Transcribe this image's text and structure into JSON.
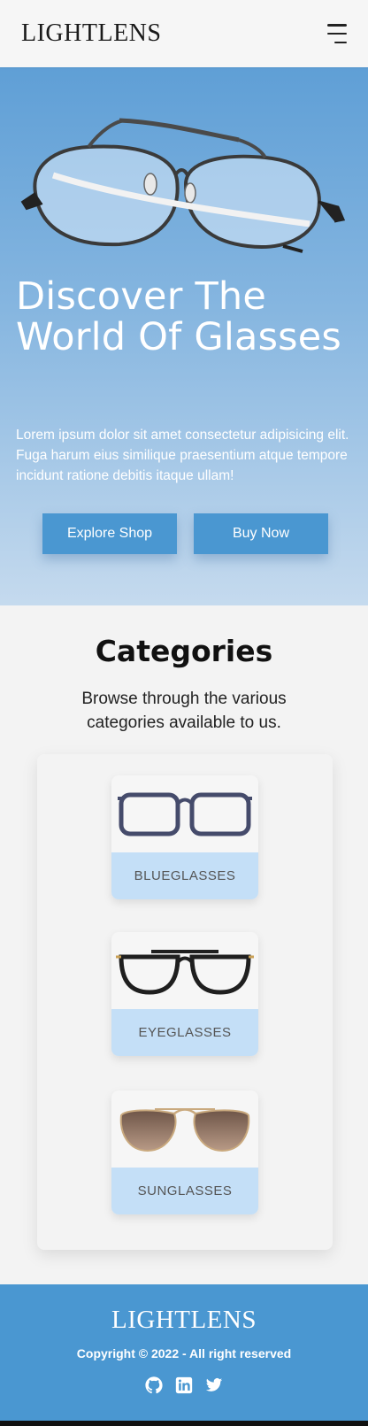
{
  "header": {
    "logo": "LIGHTLENS",
    "menu_icon": "hamburger-menu-icon"
  },
  "hero": {
    "title": "Discover The World Of Glasses",
    "text": "Lorem ipsum dolor sit amet consectetur adipisicing elit. Fuga harum eius similique praesentium atque tempore incidunt ratione debitis itaque ullam!",
    "buttons": {
      "explore": "Explore Shop",
      "buy": "Buy Now"
    }
  },
  "categories": {
    "title": "Categories",
    "subtitle": "Browse through the various categories available to us.",
    "items": [
      {
        "label": "BLUEGLASSES"
      },
      {
        "label": "EYEGLASSES"
      },
      {
        "label": "SUNGLASSES"
      }
    ]
  },
  "footer": {
    "logo": "LIGHTLENS",
    "copyright": "Copyright © 2022 - All right reserved",
    "social": [
      "github-icon",
      "linkedin-icon",
      "twitter-icon"
    ]
  },
  "colors": {
    "accent": "#4a97d1",
    "card_label_bg": "#c4dff7",
    "hero_top": "#5f9fd6",
    "hero_bottom": "#c5daee"
  }
}
